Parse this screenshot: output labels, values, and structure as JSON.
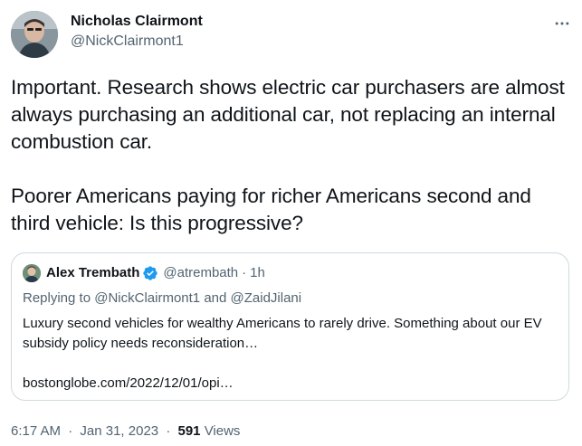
{
  "tweet": {
    "author": {
      "display_name": "Nicholas Clairmont",
      "handle": "@NickClairmont1"
    },
    "text_paragraphs": [
      "Important. Research shows electric car purchasers are almost always purchasing an additional car, not replacing an internal combustion car.",
      "Poorer Americans paying for richer Americans second and third vehicle: Is this progressive?"
    ],
    "quote": {
      "display_name": "Alex Trembath",
      "handle": "@atrembath",
      "separator": "·",
      "time": "1h",
      "replying_prefix": "Replying to",
      "reply_mention_1": "@NickClairmont1",
      "reply_and": "and",
      "reply_mention_2": "@ZaidJilani",
      "body": "Luxury second vehicles for wealthy Americans to rarely drive. Something about our EV subsidy policy needs reconsideration…",
      "url": "bostonglobe.com/2022/12/01/opi…"
    },
    "meta": {
      "time": "6:17 AM",
      "separator": "·",
      "date": "Jan 31, 2023",
      "views_count": "591",
      "views_label": "Views"
    }
  },
  "icons": {
    "more": "more-horizontal-icon",
    "verified": "verified-badge-icon"
  },
  "colors": {
    "text_primary": "#0f1419",
    "text_secondary": "#536471",
    "border": "#cfd9de",
    "verified": "#1d9bf0"
  }
}
